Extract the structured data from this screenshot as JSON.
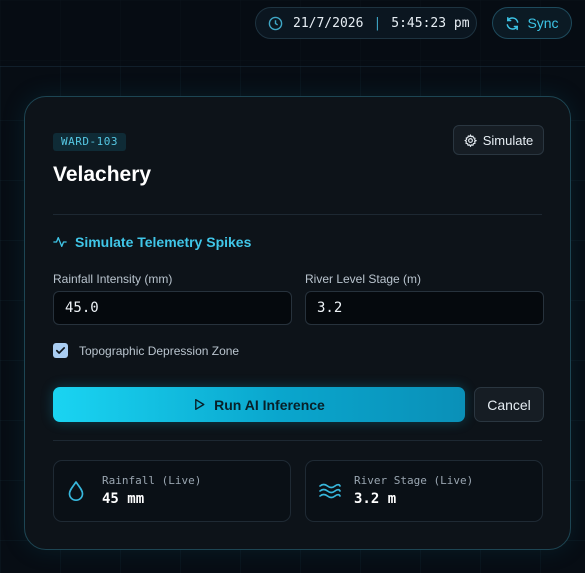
{
  "header": {
    "date": "21/7/2026",
    "separator": "|",
    "time": "5:45:23 pm",
    "sync_label": "Sync"
  },
  "card": {
    "ward_id": "WARD-103",
    "name": "Velachery",
    "simulate_label": "Simulate",
    "section_title": "Simulate Telemetry Spikes",
    "rainfall": {
      "label": "Rainfall Intensity (mm)",
      "value": "45.0"
    },
    "river": {
      "label": "River Level Stage (m)",
      "value": "3.2"
    },
    "checkbox": {
      "label": "Topographic Depression Zone",
      "checked": true
    },
    "run_label": "Run AI Inference",
    "cancel_label": "Cancel",
    "metrics": [
      {
        "label": "Rainfall (Live)",
        "value": "45 mm",
        "icon": "droplet-icon"
      },
      {
        "label": "River Stage (Live)",
        "value": "3.2 m",
        "icon": "waves-icon"
      }
    ]
  },
  "colors": {
    "accent": "#40c6e8",
    "background": "#070d14",
    "card": "#0d1319"
  }
}
